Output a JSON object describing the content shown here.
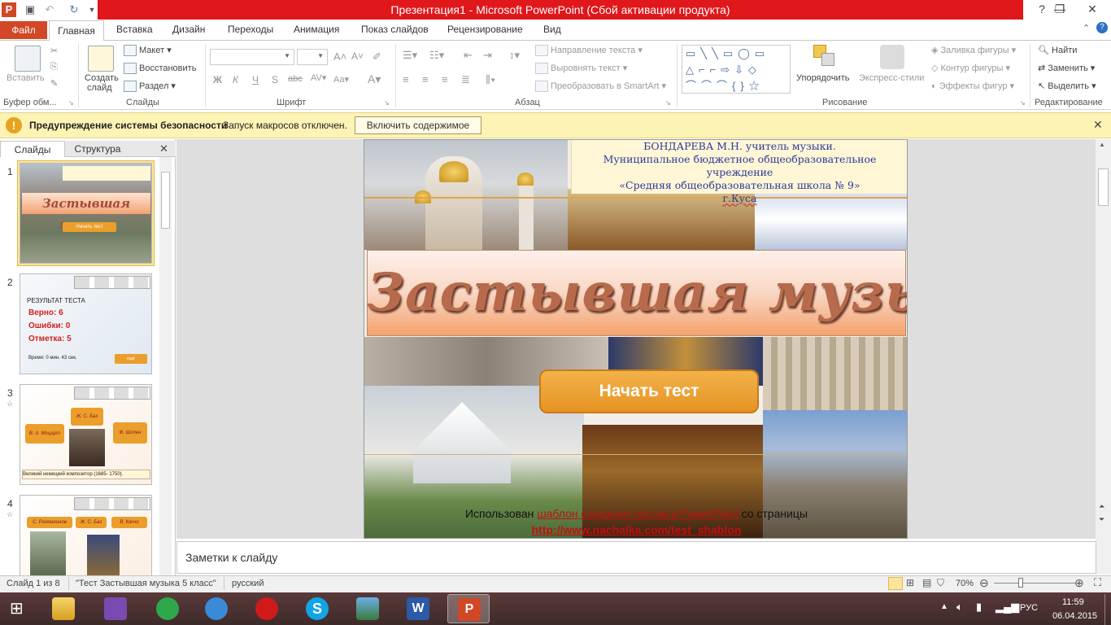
{
  "window": {
    "title": "Презентация1 - Microsoft PowerPoint (Сбой активации продукта)"
  },
  "tabs": [
    "Файл",
    "Главная",
    "Вставка",
    "Дизайн",
    "Переходы",
    "Анимация",
    "Показ слайдов",
    "Рецензирование",
    "Вид"
  ],
  "ribbon": {
    "clipboard": {
      "paste": "Вставить",
      "group": "Буфер обм..."
    },
    "slides": {
      "new_slide_1": "Создать",
      "new_slide_2": "слайд",
      "layout": "Макет",
      "reset": "Восстановить",
      "section": "Раздел",
      "group": "Слайды"
    },
    "font": {
      "group": "Шрифт"
    },
    "paragraph": {
      "text_direction": "Направление текста",
      "align_text": "Выровнять текст",
      "smartart": "Преобразовать в SmartArt",
      "group": "Абзац"
    },
    "drawing": {
      "arrange": "Упорядочить",
      "quick_styles": "Экспресс-стили",
      "fill": "Заливка фигуры",
      "outline": "Контур фигуры",
      "effects": "Эффекты фигур",
      "group": "Рисование"
    },
    "editing": {
      "find": "Найти",
      "replace": "Заменить",
      "select": "Выделить",
      "group": "Редактирование"
    }
  },
  "security": {
    "title": "Предупреждение системы безопасности",
    "message": "Запуск макросов отключен.",
    "button": "Включить содержимое"
  },
  "panel_tabs": [
    "Слайды",
    "Структура"
  ],
  "thumbnails": [
    {
      "num": "1",
      "title": "Застывшая музыка",
      "btn": "Начать тест"
    },
    {
      "num": "2",
      "header": "РЕЗУЛЬТАТ ТЕСТА",
      "l1": "Верно: 6",
      "l2": "Ошибки: 0",
      "l3": "Отметка: 5",
      "time": "Время: 0 мин. 43 сек.",
      "btn": "ещё"
    },
    {
      "num": "3",
      "c1": "Ж. С. Бах",
      "c2": "В. А. Моцарт",
      "c3": "Ф. Шопен",
      "caption": "Великий немецкий композитор (1685- 1750)."
    },
    {
      "num": "4",
      "c1": "С. Рахманинов",
      "c2": "Ж. С. Бах",
      "c3": "В. Каччи"
    }
  ],
  "slide": {
    "author": "БОНДАРЕВА М.Н. учитель музыки.",
    "school1": "Муниципальное бюджетное общеобразовательное учреждение",
    "school2": "«Средняя общеобразовательная школа № 9»",
    "city": "г.Куса",
    "title": "Застывшая музыка",
    "start_button": "Начать тест",
    "credit_prefix": "Использован",
    "credit_link": "шаблон создания тестов в PowerPoint",
    "credit_suffix": "со страницы",
    "url": "http://www.nachalka.com/test_shablon"
  },
  "notes": {
    "placeholder": "Заметки к слайду"
  },
  "status": {
    "slide": "Слайд 1 из 8",
    "theme": "\"Тест  Застывшая музыка 5 класс\"",
    "lang": "русский",
    "zoom": "70%"
  },
  "taskbar": {
    "lang": "РУС",
    "time": "11:59",
    "date": "06.04.2015"
  },
  "colors": {
    "accent": "#d24726",
    "titlebar": "#e0171b",
    "button": "#eb9e2b",
    "security_bar": "#fdf3b4"
  }
}
